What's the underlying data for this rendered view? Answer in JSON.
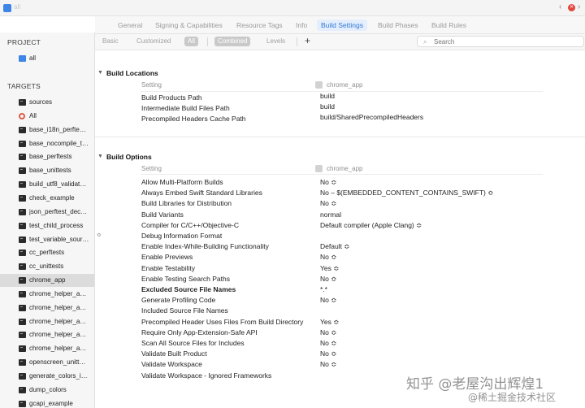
{
  "window": {
    "crumb": "all"
  },
  "editor_tabs": [
    "General",
    "Signing & Capabilities",
    "Resource Tags",
    "Info",
    "Build Settings",
    "Build Phases",
    "Build Rules"
  ],
  "active_editor_tab": "Build Settings",
  "sidebar": {
    "project_header": "PROJECT",
    "project_item": "all",
    "targets_header": "TARGETS",
    "targets": [
      "sources",
      "All",
      "base_i18n_perfte…",
      "base_nocompile_t…",
      "base_perftests",
      "base_unittests",
      "build_utf8_validat…",
      "check_example",
      "json_perftest_dec…",
      "test_child_process",
      "test_variable_sour…",
      "cc_perftests",
      "cc_unittests",
      "chrome_app",
      "chrome_helper_a…",
      "chrome_helper_a…",
      "chrome_helper_a…",
      "chrome_helper_a…",
      "chrome_helper_a…",
      "openscreen_unitt…",
      "generate_colors_i…",
      "dump_colors",
      "gcapi_example"
    ],
    "selected_target": "chrome_app"
  },
  "filter_bar": {
    "basic": "Basic",
    "customized": "Customized",
    "all": "All",
    "combined": "Combined",
    "levels": "Levels",
    "add": "+",
    "search_placeholder": "Search"
  },
  "build_locations": {
    "title": "Build Locations",
    "col_setting": "Setting",
    "col_target": "chrome_app",
    "rows": [
      {
        "name": "Build Products Path",
        "value": "build"
      },
      {
        "name": "Intermediate Build Files Path",
        "value": "build"
      },
      {
        "name": "Precompiled Headers Cache Path",
        "value": "build/SharedPrecompiledHeaders"
      }
    ]
  },
  "build_options": {
    "title": "Build Options",
    "col_setting": "Setting",
    "col_target": "chrome_app",
    "rows": [
      {
        "name": "Allow Multi-Platform Builds",
        "value": "No ≎",
        "bold": false
      },
      {
        "name": "Always Embed Swift Standard Libraries",
        "value": "No  –  $(EMBEDDED_CONTENT_CONTAINS_SWIFT) ≎",
        "bold": false
      },
      {
        "name": "Build Libraries for Distribution",
        "value": "No ≎",
        "bold": false
      },
      {
        "name": "Build Variants",
        "value": "normal",
        "bold": false
      },
      {
        "name": "Compiler for C/C++/Objective-C",
        "value": "Default compiler (Apple Clang) ≎",
        "bold": false
      },
      {
        "name": "Debug Information Format",
        "value": "",
        "bold": false
      },
      {
        "name": "Enable Index-While-Building Functionality",
        "value": "Default ≎",
        "bold": false
      },
      {
        "name": "Enable Previews",
        "value": "No ≎",
        "bold": false
      },
      {
        "name": "Enable Testability",
        "value": "Yes ≎",
        "bold": false
      },
      {
        "name": "Enable Testing Search Paths",
        "value": "No ≎",
        "bold": false
      },
      {
        "name": "Excluded Source File Names",
        "value": "*.*",
        "bold": true
      },
      {
        "name": "Generate Profiling Code",
        "value": "No ≎",
        "bold": false
      },
      {
        "name": "Included Source File Names",
        "value": "",
        "bold": false
      },
      {
        "name": "Precompiled Header Uses Files From Build Directory",
        "value": "Yes ≎",
        "bold": false
      },
      {
        "name": "Require Only App-Extension-Safe API",
        "value": "No ≎",
        "bold": false
      },
      {
        "name": "Scan All Source Files for Includes",
        "value": "No ≎",
        "bold": false
      },
      {
        "name": "Validate Built Product",
        "value": "No ≎",
        "bold": false
      },
      {
        "name": "Validate Workspace",
        "value": "No ≎",
        "bold": false
      },
      {
        "name": "Validate Workspace - Ignored Frameworks",
        "value": "",
        "bold": false
      }
    ]
  },
  "watermark": {
    "line1": "知乎 @老屋沟出辉煌1",
    "line2": "@稀土掘金技术社区"
  }
}
